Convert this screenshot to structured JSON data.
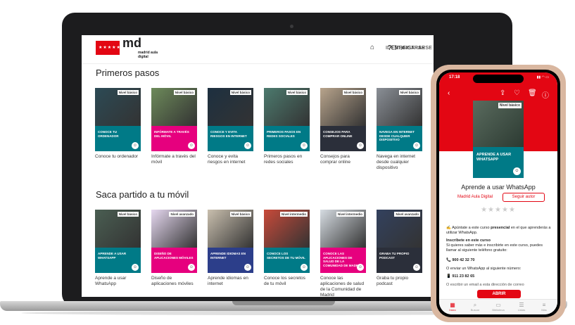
{
  "header": {
    "logo_letters": "md",
    "logo_sub": "madrid aula digital",
    "nav": [
      "IDENTIFICARSE",
      "REGISTRARSE"
    ]
  },
  "sections": [
    {
      "title": "Primeros pasos",
      "cards": [
        {
          "band": "CONOCE TU ORDENADOR",
          "caption": "Conoce tu ordenador",
          "level": "Nivel básico",
          "band_color": "#007a87",
          "photo_color": "#2c4a55"
        },
        {
          "band": "INFÓRMATE A TRAVÉS DEL MÓVIL",
          "caption": "Infórmate a través del móvil",
          "level": "Nivel básico",
          "band_color": "#e6007e",
          "photo_color": "#6d8a5a"
        },
        {
          "band": "CONOCE Y EVITA RIESGOS EN INTERNET",
          "caption": "Conoce y evita riesgos en internet",
          "level": "Nivel básico",
          "band_color": "#007a87",
          "photo_color": "#1d3040"
        },
        {
          "band": "PRIMEROS PASOS EN REDES SOCIALES",
          "caption": "Primeros pasos en redes sociales",
          "level": "Nivel básico",
          "band_color": "#007a87",
          "photo_color": "#4c7a6e"
        },
        {
          "band": "CONSEJOS PARA COMPRAR ONLINE",
          "caption": "Consejos para comprar online",
          "level": "Nivel básico",
          "band_color": "#2b2f3a",
          "photo_color": "#b8a48c"
        },
        {
          "band": "NAVEGA EN INTERNET DESDE CUALQUIER DISPOSITIVO",
          "caption": "Navega en internet desde cualquier dispositivo",
          "level": "Nivel básico",
          "band_color": "#007a87",
          "photo_color": "#8a8f96"
        }
      ]
    },
    {
      "title": "Saca partido a tu móvil",
      "cards": [
        {
          "band": "APRENDE A USAR WHATSAPP",
          "caption": "Aprende a usar WhatsApp",
          "level": "Nivel básico",
          "band_color": "#007a87",
          "photo_color": "#4a5e52"
        },
        {
          "band": "DISEÑO DE APLICACIONES MÓVILES",
          "caption": "Diseño de aplicaciones móviles",
          "level": "Nivel avanzado",
          "band_color": "#e6007e",
          "photo_color": "#e6d8f0"
        },
        {
          "band": "APRENDE IDIOMAS EN INTERNET",
          "caption": "Aprende idiomas en internet",
          "level": "Nivel básico",
          "band_color": "#2c3e8a",
          "photo_color": "#c9bfae"
        },
        {
          "band": "CONOCE LOS SECRETOS DE TU MÓVIL",
          "caption": "Conoce los secretos de tu móvil",
          "level": "Nivel intermedio",
          "band_color": "#007a87",
          "photo_color": "#c84a3a"
        },
        {
          "band": "CONOCE LAS APLICACIONES DE SALUD DE LA COMUNIDAD DE MADRID",
          "caption": "Conoce las aplicaciones de salud de la Comunidad de Madrid",
          "level": "Nivel intermedio",
          "band_color": "#e6007e",
          "photo_color": "#d6dce2"
        },
        {
          "band": "GRABA TU PROPIO PODCAST",
          "caption": "Graba tu propio podcast",
          "level": "Nivel avanzado",
          "band_color": "#2b2f3a",
          "photo_color": "#33415e"
        }
      ]
    }
  ],
  "phone": {
    "time": "17:18",
    "course_band": "APRENDE A USAR WHATSAPP",
    "course_level": "Nivel básico",
    "title": "Aprende a usar WhatsApp",
    "author": "Madrid Aula Digital",
    "follow": "Seguir autor",
    "stars": "★★★★★",
    "p1_pre": "✍ Apúntate a este curso ",
    "p1_bold": "presencial",
    "p1_post": " en el que aprenderás a utilizar WhatsApp.",
    "p2_head": "Inscríbete en este curso",
    "p2_body": "Si quieres saber más e inscribirte en este curso, puedes llamar al siguiente teléfono gratuito:",
    "phone_num": "📞 900 42 32 70",
    "p3": "O enviar un WhatsApp al siguiente número:",
    "wa_num": "📱 911 23 82 65",
    "p4": "O escribir un email a esta dirección de correo",
    "open": "ABRIR",
    "tabs": [
      "Inicio",
      "Buscar",
      "Biblioteca",
      "Listas",
      "Más"
    ]
  },
  "colors": {
    "brand": "#e30613",
    "teal": "#007a87",
    "magenta": "#e6007e"
  }
}
